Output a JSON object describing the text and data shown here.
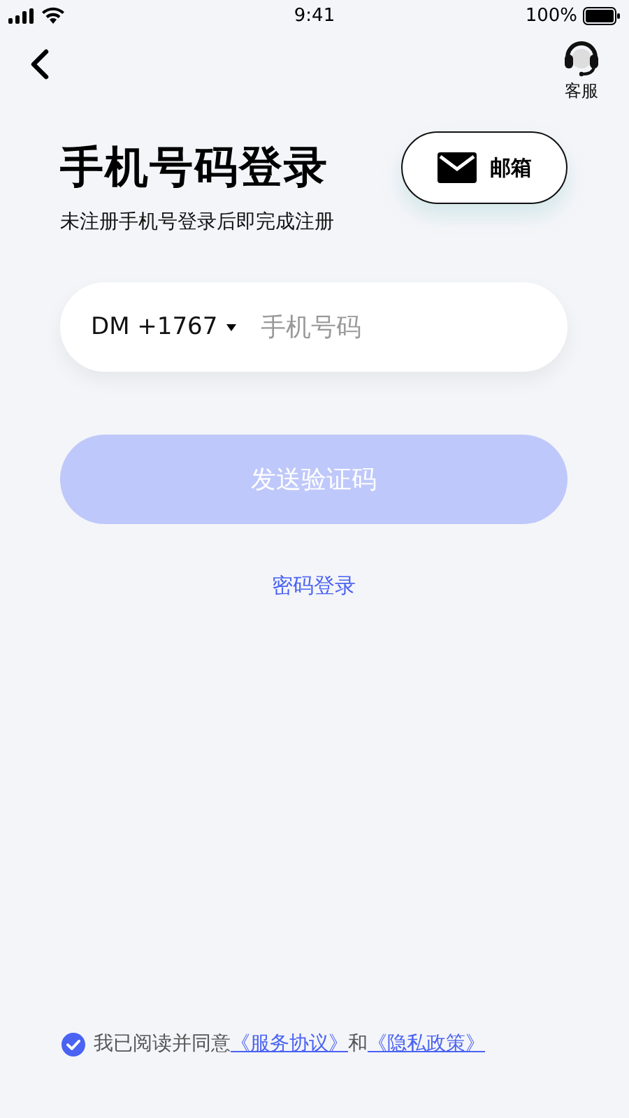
{
  "status_bar": {
    "time": "9:41",
    "battery": "100%"
  },
  "nav": {
    "support_label": "客服"
  },
  "header": {
    "title": "手机号码登录",
    "subtitle": "未注册手机号登录后即完成注册",
    "email_button": "邮箱"
  },
  "phone_field": {
    "country_code": "DM +1767",
    "placeholder": "手机号码"
  },
  "send_button": {
    "label": "发送验证码",
    "disabled": true
  },
  "password_login": "密码登录",
  "agreement": {
    "checked": true,
    "parts": [
      {
        "kind": "text",
        "text": "我已阅读并同意"
      },
      {
        "kind": "link",
        "text": "《服务协议》"
      },
      {
        "kind": "text",
        "text": "和"
      },
      {
        "kind": "link",
        "text": "《隐私政策》"
      }
    ]
  }
}
